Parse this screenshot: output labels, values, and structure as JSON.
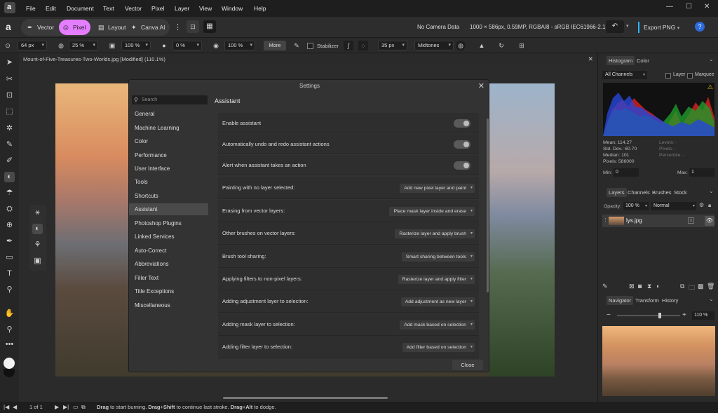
{
  "menubar": {
    "items": [
      "File",
      "Edit",
      "Document",
      "Text",
      "Vector",
      "Pixel",
      "Layer",
      "View",
      "Window",
      "Help"
    ]
  },
  "toolbar": {
    "personas": [
      {
        "label": "Vector",
        "icon": "vector-icon"
      },
      {
        "label": "Pixel",
        "icon": "pixel-icon",
        "active": true
      },
      {
        "label": "Layout",
        "icon": "layout-icon"
      },
      {
        "label": "Canva AI",
        "icon": "canva-ai-icon"
      }
    ],
    "camera_data": "No Camera Data",
    "doc_info": "1000 × 586px, 0.59MP, RGBA/8 - sRGB IEC61966-2.1",
    "export_label": "Export PNG",
    "pixel_active_color": "#e57dff",
    "export_accent_color": "#2db7ff"
  },
  "context": {
    "size": "64 px",
    "opacity": "25 %",
    "flow": "100 %",
    "hardness": "0 %",
    "strength": "100 %",
    "more": "More",
    "stabilizer": "Stabilizer",
    "radius": "35 px",
    "tones": "Midtones"
  },
  "document": {
    "tab_title": "Mount-of-Five-Treasures-Two-Worlds.jpg [Modified] (110.1%)"
  },
  "settings": {
    "title": "Settings",
    "search_placeholder": "Search",
    "nav": [
      "General",
      "Machine Learning",
      "Color",
      "Performance",
      "User Interface",
      "Tools",
      "Shortcuts",
      "Assistant",
      "Photoshop Plugins",
      "Linked Services",
      "Auto-Correct",
      "Abbreviations",
      "Filler Text",
      "Title Exceptions",
      "Miscellaneous"
    ],
    "selected_nav": "Assistant",
    "pane_title": "Assistant",
    "toggles": [
      {
        "label": "Enable assistant"
      },
      {
        "label": "Automatically undo and redo assistant actions"
      },
      {
        "label": "Alert when assistant takes an action"
      }
    ],
    "options": [
      {
        "label": "Painting with no layer selected:",
        "value": "Add new pixel layer and paint"
      },
      {
        "label": "Erasing from vector layers:",
        "value": "Place mask layer inside and erase"
      },
      {
        "label": "Other brushes on vector layers:",
        "value": "Rasterize layer and apply brush"
      },
      {
        "label": "Brush tool sharing:",
        "value": "Smart sharing between tools"
      },
      {
        "label": "Applying filters to non-pixel layers:",
        "value": "Rasterize layer and apply filter"
      },
      {
        "label": "Adding adjustment layer to selection:",
        "value": "Add adjustment as new layer"
      },
      {
        "label": "Adding mask layer to selection:",
        "value": "Add mask based on selection"
      },
      {
        "label": "Adding filter layer to selection:",
        "value": "Add filter based on selection"
      }
    ],
    "close_label": "Close"
  },
  "histogram": {
    "tabs": [
      "Histogram",
      "Color"
    ],
    "channel": "All Channels",
    "layer_label": "Layer",
    "marquee_label": "Marquee",
    "mean": "Mean: 114.27",
    "stddev": "Std. Dev.: 60.70",
    "median": "Median: 101",
    "pixels": "Pixels: 586000",
    "levels": "Levels: -",
    "pixels_r": "Pixels: -",
    "percentile": "Percentile: -",
    "min_label": "Min:",
    "min_value": "0",
    "max_label": "Max:",
    "max_value": "1"
  },
  "layers": {
    "tabs": [
      "Layers",
      "Channels",
      "Brushes",
      "Stock"
    ],
    "opacity_label": "Opacity:",
    "opacity_value": "100 %",
    "blend_mode": "Normal",
    "layer_name": "lys.jpg"
  },
  "navigator": {
    "tabs": [
      "Navigator",
      "Transform",
      "History"
    ],
    "zoom": "110 %"
  },
  "status": {
    "page": "1 of 1",
    "hint_parts": [
      "Drag",
      " to start burning. ",
      "Drag",
      "+",
      "Shift",
      " to continue last stroke. ",
      "Drag",
      "+",
      "Alt",
      " to dodge."
    ]
  }
}
